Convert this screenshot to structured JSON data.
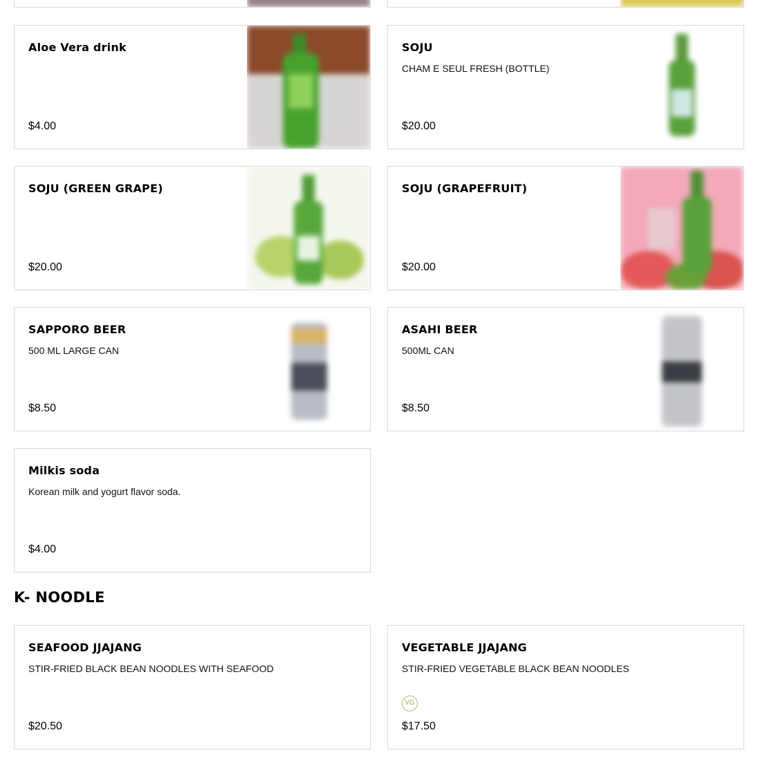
{
  "drinks": {
    "items": [
      {
        "name": "Aloe Vera drink",
        "description": "",
        "price": "$4.00",
        "image": "aloe-vera-bottle"
      },
      {
        "name": "SOJU",
        "description": "CHAM E SEUL FRESH (BOTTLE)",
        "price": "$20.00",
        "image": "soju-bottle"
      },
      {
        "name": "SOJU (GREEN GRAPE)",
        "description": "",
        "price": "$20.00",
        "image": "soju-green-grape-bottle"
      },
      {
        "name": "SOJU (GRAPEFRUIT)",
        "description": "",
        "price": "$20.00",
        "image": "soju-grapefruit-bottle"
      },
      {
        "name": "SAPPORO BEER",
        "description": "500 ML LARGE CAN",
        "price": "$8.50",
        "image": "sapporo-can"
      },
      {
        "name": "ASAHI BEER",
        "description": "500ML CAN",
        "price": "$8.50",
        "image": "asahi-can"
      },
      {
        "name": "Milkis soda",
        "description": "Korean milk and yogurt flavor soda.",
        "price": "$4.00"
      }
    ]
  },
  "k_noodle": {
    "title": "K- NOODLE",
    "items": [
      {
        "name": "SEAFOOD JJAJANG",
        "description": "STIR-FRIED BLACK BEAN NOODLES WITH SEAFOOD",
        "price": "$20.50"
      },
      {
        "name": "VEGETABLE JJAJANG",
        "description": "STIR-FRIED VEGETABLE BLACK BEAN NOODLES",
        "price": "$17.50",
        "badge": "VG"
      }
    ]
  },
  "colors": {
    "border": "#d9d9d9",
    "vg_badge": "#a7bf6d"
  }
}
